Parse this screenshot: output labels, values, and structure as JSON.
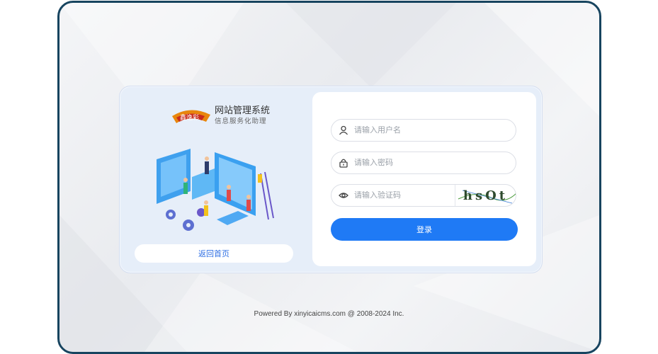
{
  "brand": {
    "logo_text": "鑫逸彩",
    "system_name": "网站管理系统",
    "system_subtitle": "信息服务化助理"
  },
  "left": {
    "home_button": "返回首页"
  },
  "form": {
    "username_placeholder": "请输入用户名",
    "password_placeholder": "请输入密码",
    "captcha_placeholder": "请输入验证码",
    "captcha_text": "hsOt",
    "login_button": "登录"
  },
  "footer": {
    "text": "Powered By xinyicaicms.com @ 2008-2024 Inc."
  },
  "colors": {
    "frame_border": "#17445f",
    "accent": "#1f7af5",
    "link": "#2f6fe4"
  },
  "icons": {
    "username": "user-icon",
    "password": "lock-icon",
    "captcha": "eye-icon"
  }
}
